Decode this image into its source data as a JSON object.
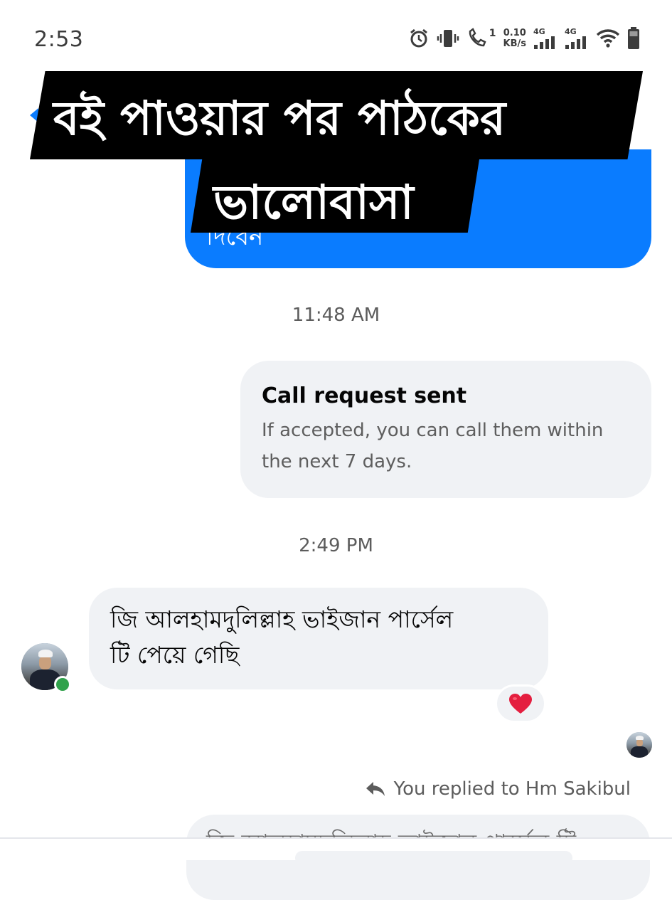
{
  "status_bar": {
    "time": "2:53",
    "net_speed_value": "0.10",
    "net_speed_unit": "KB/s",
    "sim1_label": "4G",
    "sim2_label": "4G",
    "call_badge": "1"
  },
  "caption": {
    "line1": "বই পাওয়ার পর পাঠকের",
    "line2": "ভালোবাসা"
  },
  "messages": {
    "sent_bubble_text": "দিবেন",
    "timestamp_1": "11:48 AM",
    "call_request": {
      "title": "Call request sent",
      "body_line1": "If accepted, you can call them within",
      "body_line2": "the next 7 days."
    },
    "timestamp_2": "2:49 PM",
    "received": {
      "line1": "জি আলহামদুলিল্লাহ ভাইজান পার্সেল",
      "line2": "টি পেয়ে গেছি",
      "reaction": "❤️"
    },
    "reply_label": "You replied to Hm Sakibul",
    "reply_bubble_text": "জি আলহামদুলিল্লাহ ভাইজান পার্সেল টি"
  },
  "colors": {
    "messenger_blue": "#0a7cff",
    "bubble_gray": "#f0f2f5",
    "online_green": "#31a24c",
    "heart_red": "#e41e3f"
  }
}
